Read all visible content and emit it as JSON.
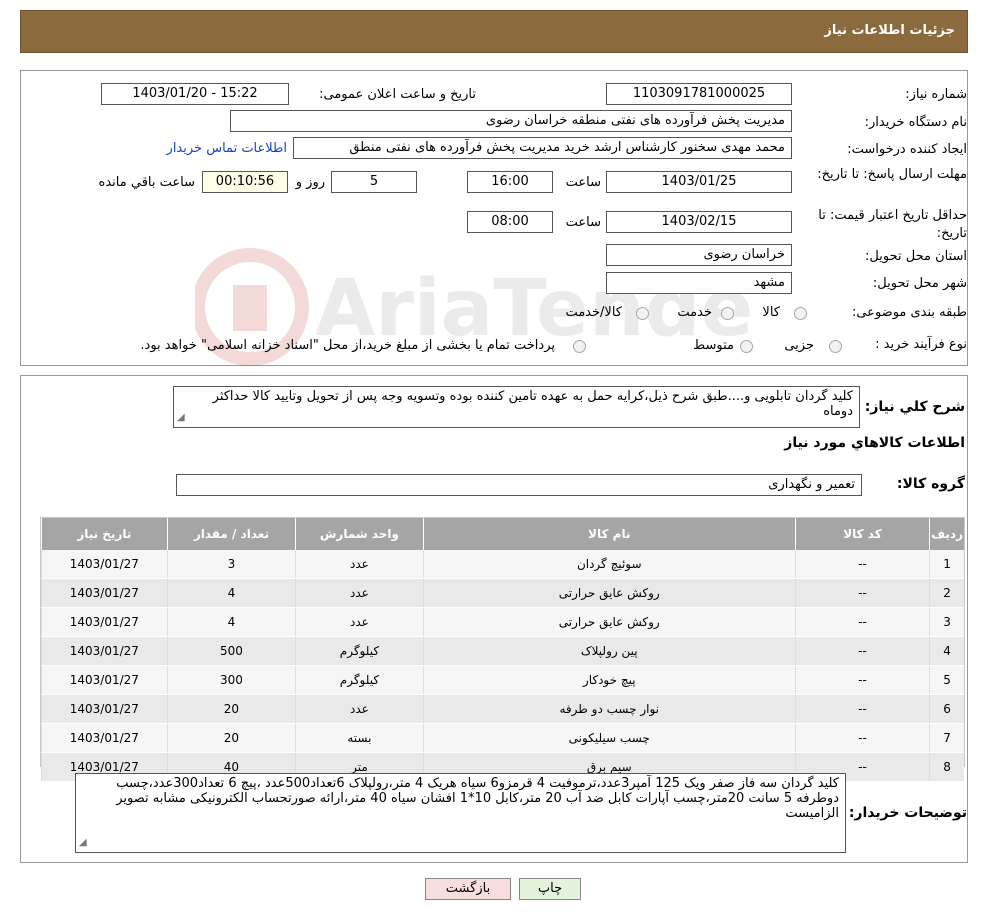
{
  "header": {
    "title": "جزئیات اطلاعات نیاز"
  },
  "fields": {
    "need_number_label": "شماره نیاز:",
    "need_number": "1103091781000025",
    "announce_label": "تاریخ و ساعت اعلان عمومی:",
    "announce_value": "1403/01/20 - 15:22",
    "buyer_label": "نام دستگاه خریدار:",
    "buyer_value": "مدیریت پخش فرآورده های نفتی منطقه خراسان رضوی",
    "creator_label": "ایجاد کننده درخواست:",
    "creator_value": "محمد مهدی سخنور کارشناس ارشد خرید مدیریت پخش فرآورده های نفتی منطق",
    "contact_link": "اطلاعات تماس خریدار",
    "deadline_label": "مهلت ارسال پاسخ: تا تاریخ:",
    "deadline_date": "1403/01/25",
    "time_label": "ساعت",
    "deadline_time": "16:00",
    "days_value": "5",
    "days_label": "روز و",
    "remaining_time": "00:10:56",
    "remaining_label": "ساعت باقي مانده",
    "validity_label": "حداقل تاریخ اعتبار قیمت: تا تاریخ:",
    "validity_date": "1403/02/15",
    "validity_time": "08:00",
    "province_label": "استان محل تحویل:",
    "province_value": "خراسان رضوی",
    "city_label": "شهر محل تحویل:",
    "city_value": "مشهد",
    "category_label": "طبقه بندی موضوعی:",
    "category_options": [
      "کالا",
      "خدمت",
      "کالا/خدمت"
    ],
    "process_label": "نوع فرآیند خرید :",
    "process_options": [
      "جزیی",
      "متوسط"
    ],
    "process_note": "پرداخت تمام یا بخشی از مبلغ خرید،از محل \"اسناد خزانه اسلامی\" خواهد بود."
  },
  "summary": {
    "label": "شرح کلي نياز:",
    "text": "کلید گردان تابلویی و....طبق شرح ذیل،کرایه حمل به عهده تامین کننده بوده وتسویه وجه پس از تحویل وتایید کالا حداکثر دوماه"
  },
  "goods": {
    "section_title": "اطلاعات کالاهاي مورد نياز",
    "group_label": "گروه کالا:",
    "group_value": "تعمیر و نگهداری",
    "columns": [
      "رديف",
      "کد کالا",
      "نام کالا",
      "واحد شمارش",
      "تعداد / مقدار",
      "تاريخ نياز"
    ],
    "rows": [
      [
        "1",
        "--",
        "سوئیچ گردان",
        "عدد",
        "3",
        "1403/01/27"
      ],
      [
        "2",
        "--",
        "روکش عایق حرارتی",
        "عدد",
        "4",
        "1403/01/27"
      ],
      [
        "3",
        "--",
        "روکش عایق حرارتی",
        "عدد",
        "4",
        "1403/01/27"
      ],
      [
        "4",
        "--",
        "پین رولپلاک",
        "کیلوگرم",
        "500",
        "1403/01/27"
      ],
      [
        "5",
        "--",
        "پیچ خودکار",
        "کیلوگرم",
        "300",
        "1403/01/27"
      ],
      [
        "6",
        "--",
        "نوار چسب دو طرفه",
        "عدد",
        "20",
        "1403/01/27"
      ],
      [
        "7",
        "--",
        "چسب سیلیکونی",
        "بسته",
        "20",
        "1403/01/27"
      ],
      [
        "8",
        "--",
        "سیم برق",
        "متر",
        "40",
        "1403/01/27"
      ]
    ]
  },
  "buyer_notes": {
    "label": "توضيحات خريدار:",
    "text": "کلید گردان سه فاز صفر ویک 125 آمپر3عدد،ترموفیت 4 قرمزو6 سیاه هریک 4 متر،رولپلاک 6تعداد500عدد ،پیچ 6 تعداد300عدد،چسب دوطرفه 5 سانت 20متر،چسب آپارات کابل  ضد آب 20 متر،کابل 10*1 افشان سیاه 40 متر،ارائه صورتحساب الکترونیکی مشابه تصویر الزامیست"
  },
  "buttons": {
    "print": "چاپ",
    "back": "بازگشت"
  },
  "watermark": {
    "text": "AriaTender.neT"
  },
  "colors": {
    "header_bg": "#8B6B3D",
    "table_header_bg": "#a5a5a5",
    "link": "#1a44c8",
    "back_button_bg": "#f8dede",
    "print_button_bg": "#e3f3dc"
  }
}
